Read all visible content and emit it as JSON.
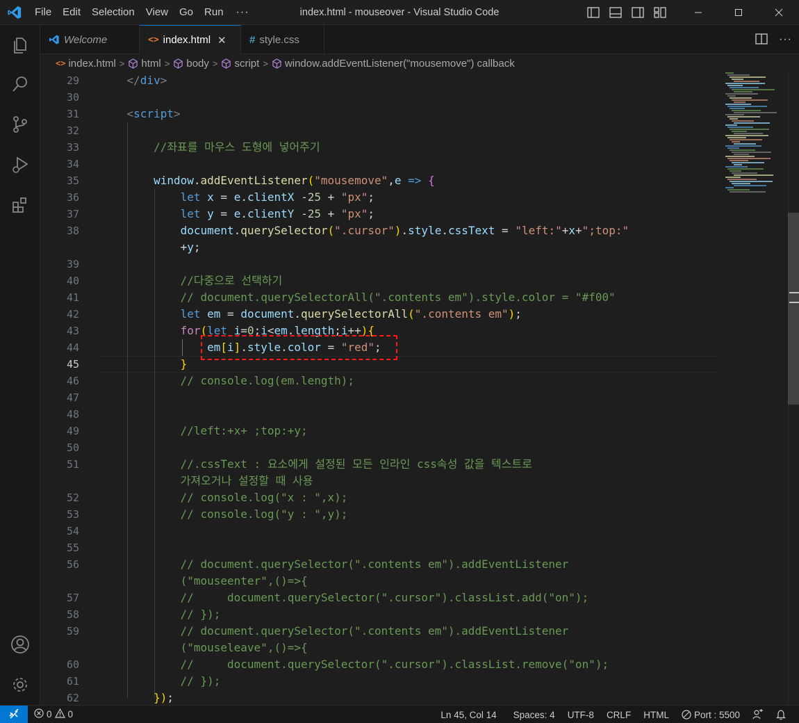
{
  "menu": [
    "File",
    "Edit",
    "Selection",
    "View",
    "Go",
    "Run",
    "···"
  ],
  "window_title": "index.html - mouseover - Visual Studio Code",
  "tabs": [
    {
      "label": "Welcome",
      "icon": "vscode-icon"
    },
    {
      "label": "index.html",
      "icon": "html-icon",
      "close": "✕"
    },
    {
      "label": "style.css",
      "icon": "css-hash-icon"
    }
  ],
  "breadcrumb": [
    "index.html",
    "html",
    "body",
    "script",
    "window.addEventListener(\"mousemove\") callback"
  ],
  "activity": [
    "explorer-icon",
    "search-icon",
    "source-control-icon",
    "run-debug-icon",
    "extensions-icon",
    "accounts-icon",
    "manage-gear-icon"
  ],
  "gutter": [
    "29",
    "30",
    "31",
    "32",
    "33",
    "34",
    "35",
    "36",
    "37",
    "38",
    "",
    "39",
    "40",
    "41",
    "42",
    "43",
    "44",
    "45",
    "46",
    "47",
    "48",
    "49",
    "50",
    "51",
    "",
    "52",
    "53",
    "54",
    "55",
    "56",
    "",
    "57",
    "58",
    "59",
    "",
    "60",
    "61",
    "62"
  ],
  "current_line": "45",
  "code": [
    "    </div>",
    "",
    "    <script>",
    "",
    "        //좌표를 마우스 도형에 넣어주기",
    "",
    "        window.addEventListener(\"mousemove\",e => {",
    "            let x = e.clientX -25 + \"px\";",
    "            let y = e.clientY -25 + \"px\";",
    "            document.querySelector(\".cursor\").style.cssText = \"left:\"+x+\";top:\"",
    "            +y;",
    "",
    "            //다중으로 선택하기",
    "            // document.querySelectorAll(\".contents em\").style.color = \"#f00\"",
    "            let em = document.querySelectorAll(\".contents em\");",
    "            for(let i=0;i<em.length;i++){",
    "                em[i].style.color = \"red\";",
    "            }",
    "            // console.log(em.length);",
    "",
    "",
    "            //left:+x+ ;top:+y;",
    "",
    "            //.cssText : 요소에게 설정된 모든 인라인 css속성 값을 텍스트로",
    "            가져오거나 설정할 때 사용",
    "            // console.log(\"x : \",x);",
    "            // console.log(\"y : \",y);",
    "",
    "",
    "            // document.querySelector(\".contents em\").addEventListener",
    "            (\"mouseenter\",()=>{",
    "            //     document.querySelector(\".cursor\").classList.add(\"on\");",
    "            // });",
    "            // document.querySelector(\".contents em\").addEventListener",
    "            (\"mouseleave\",()=>{",
    "            //     document.querySelector(\".cursor\").classList.remove(\"on\");",
    "            // });",
    "        });"
  ],
  "status": {
    "errors": "0",
    "warnings": "0",
    "position": "Ln 45, Col 14",
    "spaces": "Spaces: 4",
    "encoding": "UTF-8",
    "eol": "CRLF",
    "language": "HTML",
    "port": "Port : 5500"
  },
  "colors": {
    "accent": "#0078d4",
    "highlight_box": "#ff1a1a",
    "background": "#1e1e1e"
  }
}
